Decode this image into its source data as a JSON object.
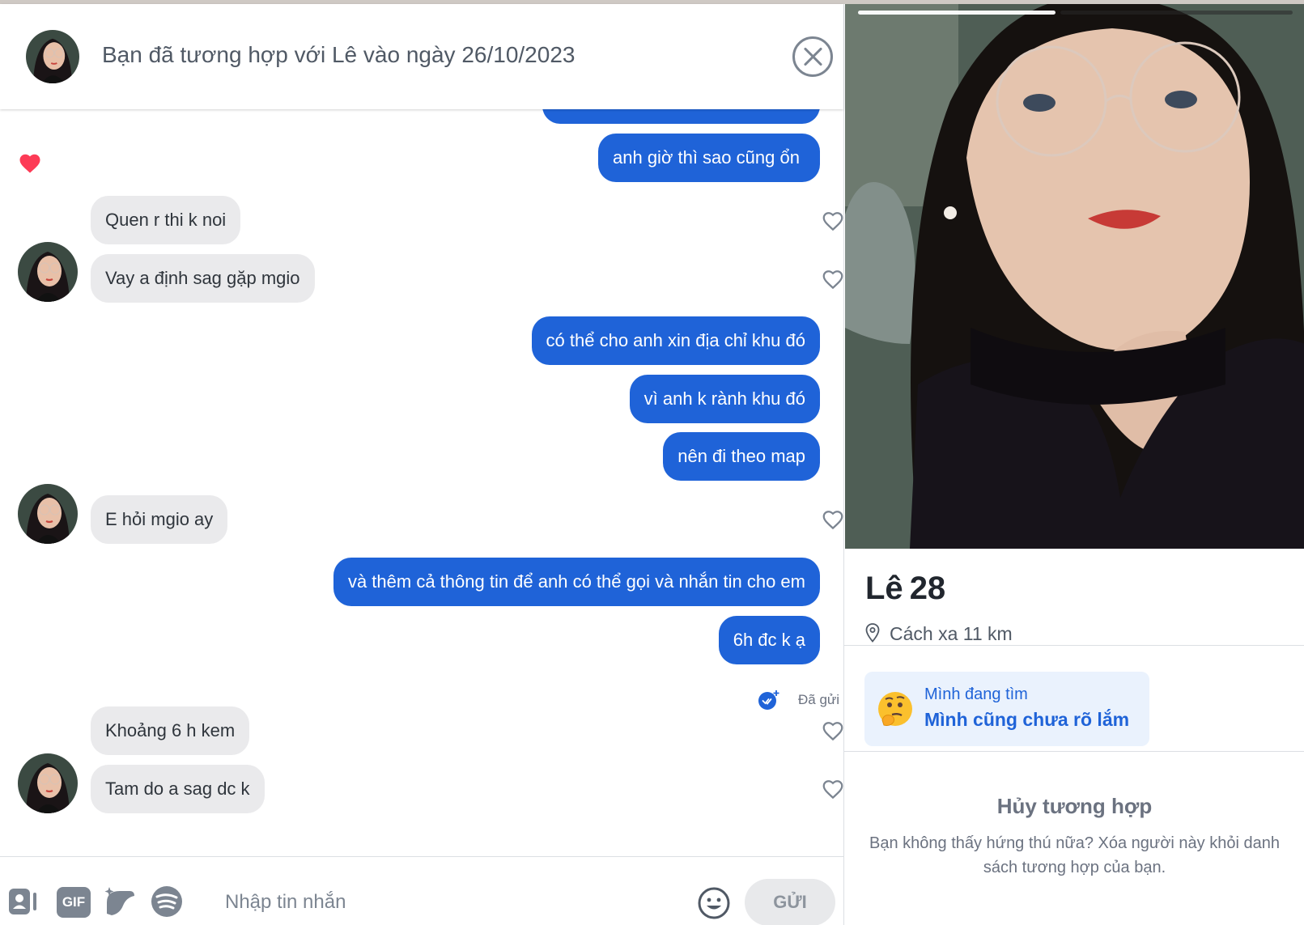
{
  "header": {
    "match_text": "Bạn đã tương hợp với Lê vào ngày 26/10/2023"
  },
  "messages": [
    {
      "direction": "out",
      "text": "anh giờ thì sao cũng ổn"
    },
    {
      "direction": "in",
      "text": "Quen r thi k noi"
    },
    {
      "direction": "in",
      "text": "Vay a định sag gặp mgio"
    },
    {
      "direction": "out",
      "text": "có thể cho anh xin địa chỉ khu đó"
    },
    {
      "direction": "out",
      "text": "vì anh k rành khu đó"
    },
    {
      "direction": "out",
      "text": "nên đi theo map"
    },
    {
      "direction": "in",
      "text": "E hỏi mgio ay"
    },
    {
      "direction": "out",
      "text": "và thêm cả thông tin để anh có thể gọi và nhắn tin cho em"
    },
    {
      "direction": "out",
      "text": "6h đc k ạ"
    },
    {
      "direction": "in",
      "text": "Khoảng 6 h kem"
    },
    {
      "direction": "in",
      "text": "Tam do a sag dc k"
    }
  ],
  "sent_status": "Đã gửi",
  "composer": {
    "gif_label": "GIF",
    "placeholder": "Nhập tin nhắn",
    "send_label": "GỬI"
  },
  "profile": {
    "name": "Lê",
    "age": "28",
    "distance": "Cách xa 11 km",
    "photo_count": 2,
    "photo_active_index": 1,
    "seeking_label": "Mình đang tìm",
    "seeking_value": "Mình cũng chưa rõ lắm",
    "unmatch_title": "Hủy tương hợp",
    "unmatch_desc": "Bạn không thấy hứng thú nữa? Xóa người này khỏi danh sách tương hợp của bạn."
  },
  "colors": {
    "accent_blue": "#1f63d8",
    "incoming_bubble": "#eaeaec",
    "heart_red": "#fd3b56"
  },
  "icons": [
    "close-icon",
    "heart-icon",
    "like-outline-icon",
    "check-sent-icon",
    "contact-card-icon",
    "gif-icon",
    "sticker-icon",
    "spotify-icon",
    "emoji-icon",
    "location-pin-icon",
    "thinking-face-icon"
  ]
}
